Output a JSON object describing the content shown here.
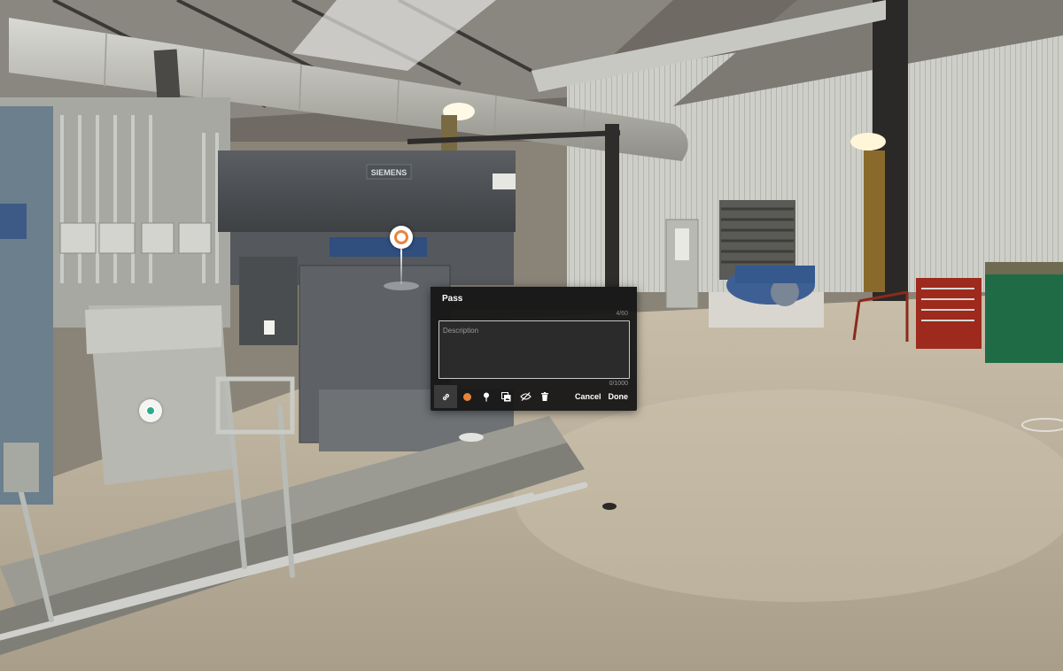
{
  "scene": {
    "equipment_brand": "SIEMENS"
  },
  "tag_editor": {
    "title_value": "Pass",
    "title_counter": "4/60",
    "description_placeholder": "Description",
    "description_value": "",
    "description_counter": "0/1000",
    "tag_color": "#e8843a",
    "tools": [
      "link-icon",
      "color-picker",
      "pin-icon",
      "media-icon",
      "hide-icon",
      "trash-icon"
    ],
    "cancel_label": "Cancel",
    "done_label": "Done"
  },
  "markers": {
    "tag_ring_color": "#e8843a",
    "sweep_color": "#2fa98c"
  }
}
